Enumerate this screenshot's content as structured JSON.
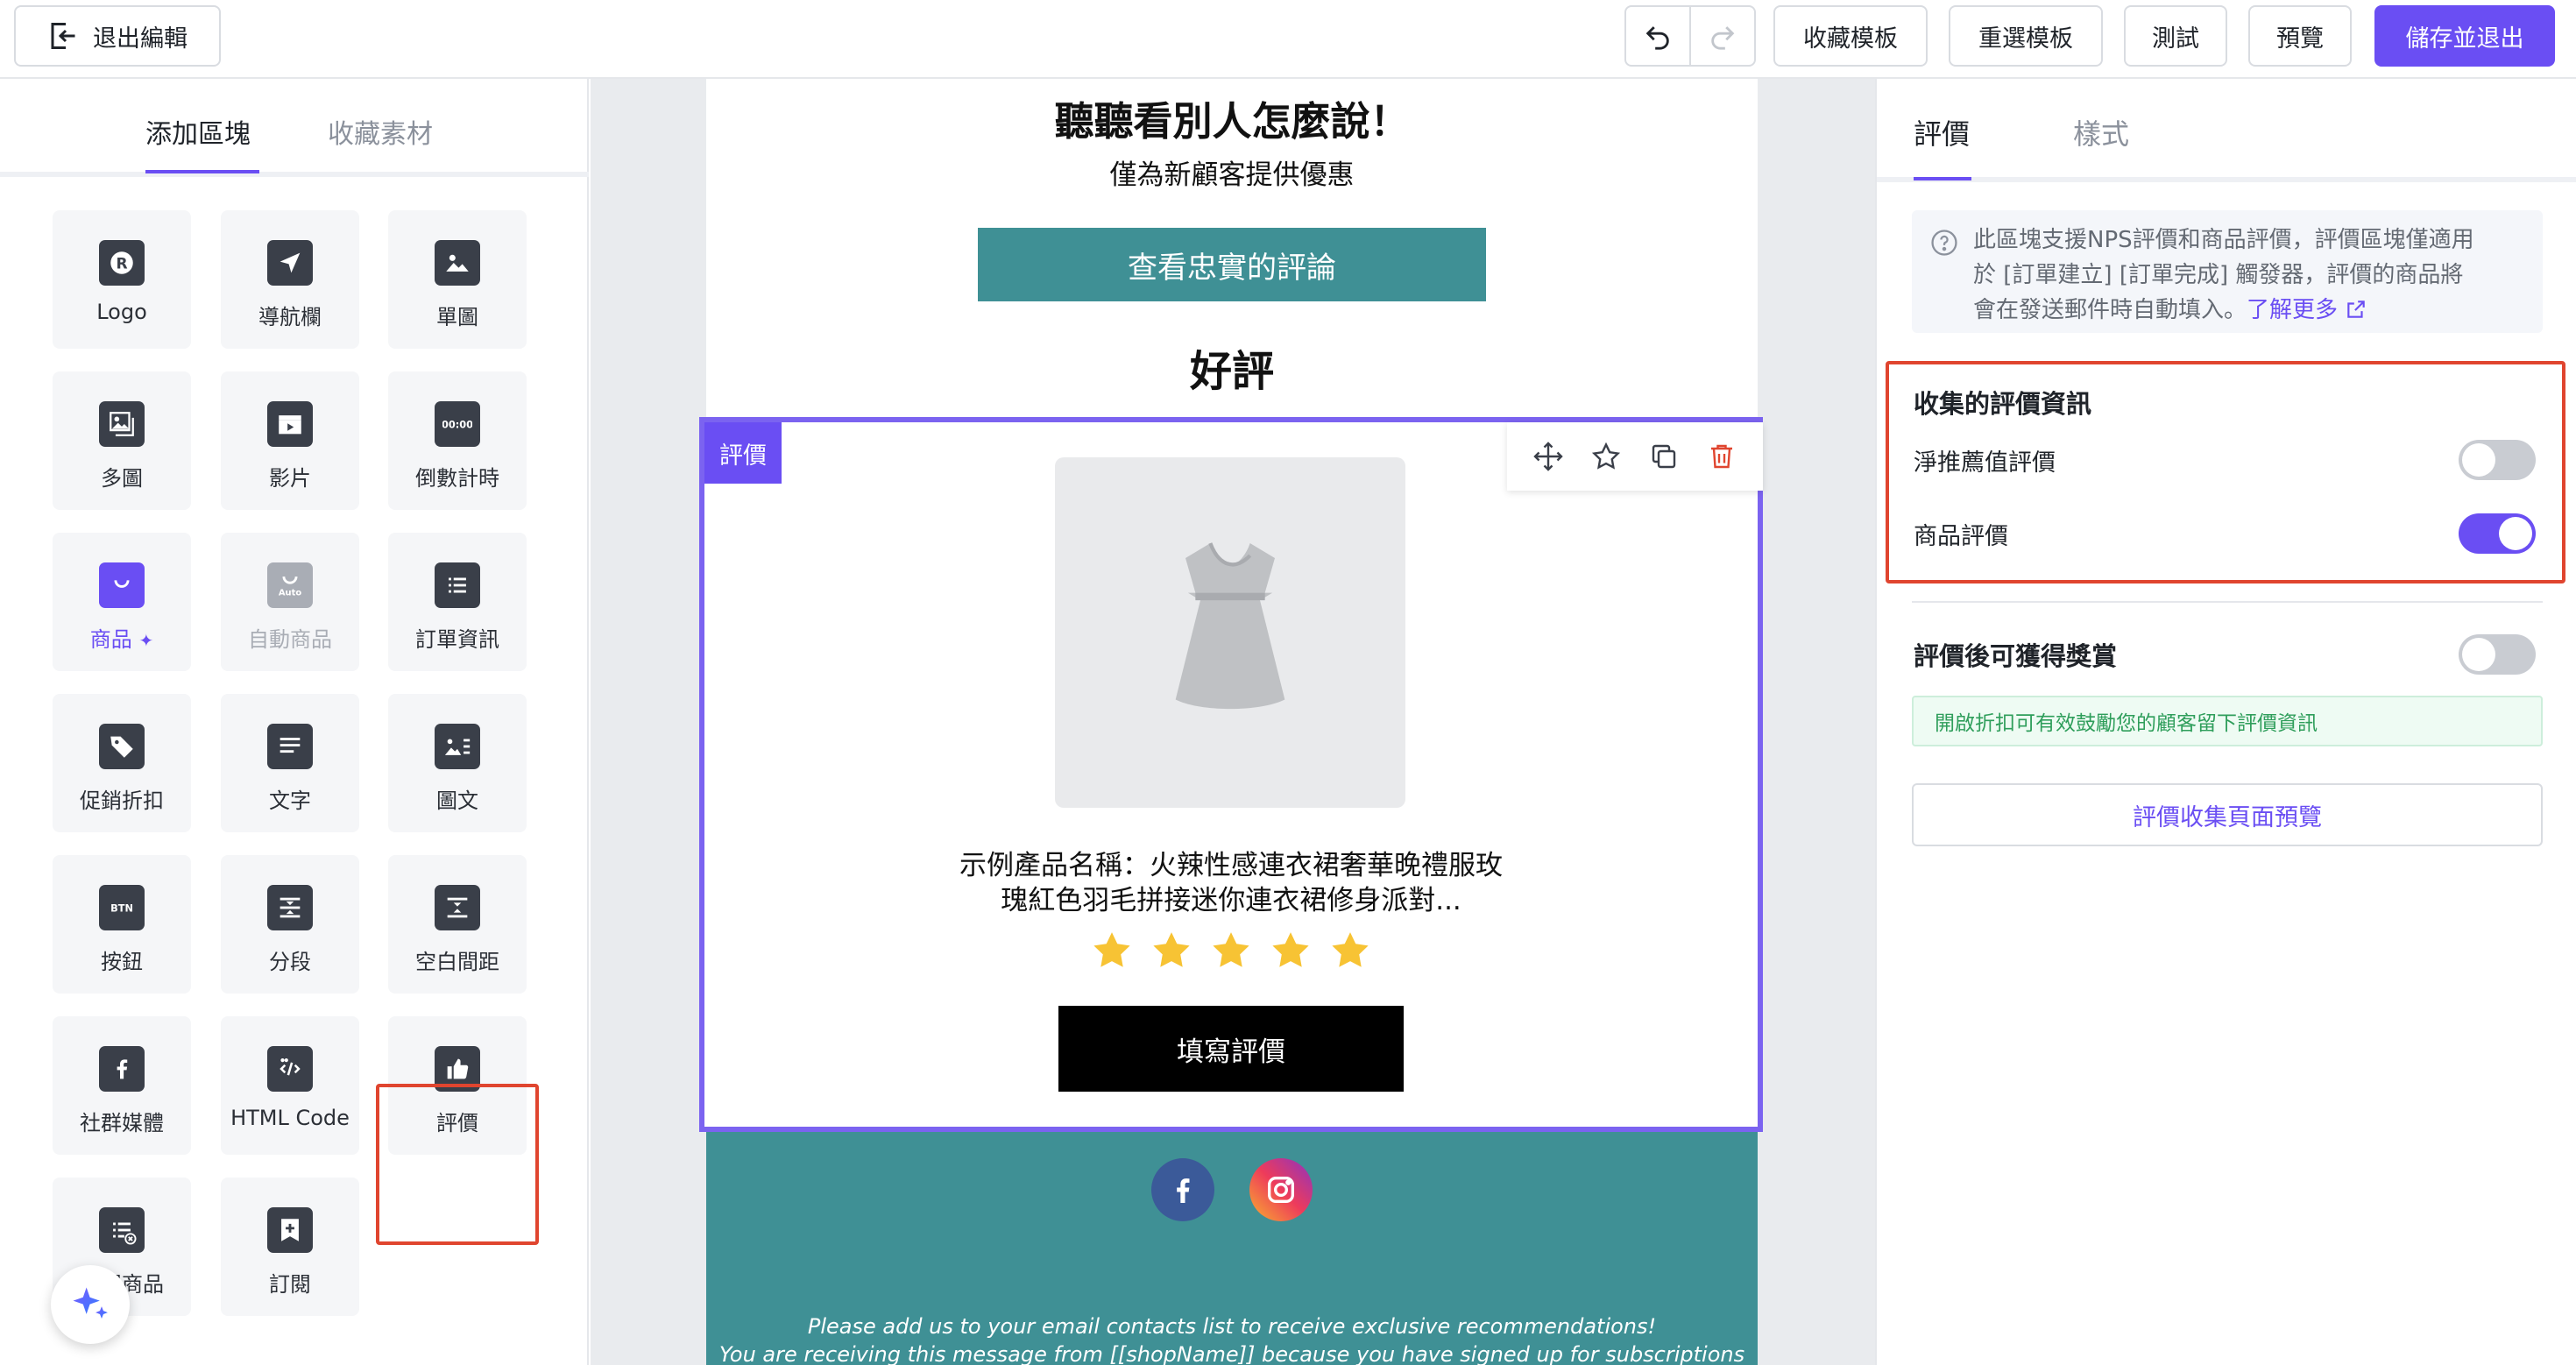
{
  "toolbar": {
    "exit_label": "退出編輯",
    "favorite_template_label": "收藏模板",
    "reselect_template_label": "重選模板",
    "test_label": "測試",
    "preview_label": "預覽",
    "save_exit_label": "儲存並退出"
  },
  "left_panel": {
    "tabs": [
      {
        "label": "添加區塊",
        "active": true
      },
      {
        "label": "收藏素材",
        "active": false
      }
    ],
    "blocks": [
      {
        "label": "Logo",
        "icon": "logo-icon"
      },
      {
        "label": "導航欄",
        "icon": "navigation-icon"
      },
      {
        "label": "單圖",
        "icon": "image-icon"
      },
      {
        "label": "多圖",
        "icon": "images-icon"
      },
      {
        "label": "影片",
        "icon": "video-icon"
      },
      {
        "label": "倒數計時",
        "icon": "countdown-icon"
      },
      {
        "label": "商品",
        "icon": "shopping-bag-icon",
        "state": "highlighted"
      },
      {
        "label": "自動商品",
        "icon": "auto-product-icon",
        "state": "disabled"
      },
      {
        "label": "訂單資訊",
        "icon": "order-info-icon"
      },
      {
        "label": "促銷折扣",
        "icon": "tag-icon"
      },
      {
        "label": "文字",
        "icon": "text-icon"
      },
      {
        "label": "圖文",
        "icon": "image-text-icon"
      },
      {
        "label": "按鈕",
        "icon": "button-icon"
      },
      {
        "label": "分段",
        "icon": "divider-icon"
      },
      {
        "label": "空白間距",
        "icon": "spacer-icon"
      },
      {
        "label": "社群媒體",
        "icon": "facebook-icon"
      },
      {
        "label": "HTML Code",
        "icon": "code-icon"
      },
      {
        "label": "評價",
        "icon": "thumbs-up-icon",
        "state": "selected"
      },
      {
        "label": "退閱商品",
        "icon": "unsubscribe-product-icon"
      },
      {
        "label": "訂閱",
        "icon": "bookmark-plus-icon"
      }
    ]
  },
  "email": {
    "title": "聽聽看別人怎麼說！",
    "subtitle": "僅為新顧客提供優惠",
    "cta_label": "查看忠實的評論",
    "section_title": "好評",
    "review_block": {
      "tag_label": "評價",
      "product_name_line1": "示例產品名稱：火辣性感連衣裙奢華晚禮服玫",
      "product_name_line2": "瑰紅色羽毛拼接迷你連衣裙修身派對...",
      "rating": 5,
      "rating_max": 5,
      "write_review_label": "填寫評價"
    },
    "footer": {
      "line1": "Please add us to your email contacts list to receive exclusive recommendations!",
      "line2": "You are receiving this message from [[shopName]] because you have signed up for subscriptions to"
    }
  },
  "right_panel": {
    "tabs": [
      {
        "label": "評價",
        "active": true
      },
      {
        "label": "樣式",
        "active": false
      }
    ],
    "info_text_line1": "此區塊支援NPS評價和商品評價，評價區塊僅適用",
    "info_text_line2": "於 [訂單建立] [訂單完成] 觸發器，評價的商品將",
    "info_text_line3": "會在發送郵件時自動填入。",
    "info_link": "了解更多",
    "collect_title": "收集的評價資訊",
    "nps_label": "淨推薦值評價",
    "nps_enabled": false,
    "product_review_label": "商品評價",
    "product_review_enabled": true,
    "reward_title": "評價後可獲得獎賞",
    "reward_enabled": false,
    "reward_note": "開啟折扣可有效鼓勵您的顧客留下評價資訊",
    "preview_button_label": "評價收集頁面預覽"
  },
  "colors": {
    "accent": "#6a4ef3",
    "teal": "#3f9095",
    "highlight_border": "#e0452f",
    "star": "#f7c334"
  }
}
